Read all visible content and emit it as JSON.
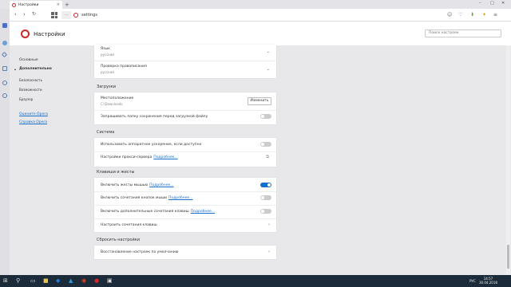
{
  "window": {
    "tab_title": "Настройки",
    "tab_close": "×",
    "new_tab": "+",
    "controls": [
      "–",
      "□",
      "✕"
    ]
  },
  "toolbar": {
    "back": "‹",
    "forward": "›",
    "reload": "↻",
    "url_badge": "···",
    "url": "settings",
    "right_icons": [
      "☺",
      "♡",
      "⬇",
      "✦",
      "≡"
    ]
  },
  "header": {
    "title": "Настройки",
    "search_placeholder": "Поиск настроек"
  },
  "leftnav": {
    "basic": "Основные",
    "advanced": "Дополнительно",
    "security": "Безопасность",
    "features": "Возможности",
    "browser": "Браузер",
    "rate": "Оцените Opera",
    "help": "Справка Opera"
  },
  "language_card": {
    "language_label": "Язык",
    "language_value": "русский",
    "spell_label": "Проверка правописания",
    "spell_value": "русский"
  },
  "downloads": {
    "section": "Загрузки",
    "location_label": "Местоположение",
    "location_value": "C:\\Downloads",
    "change_button": "Изменить",
    "ask_label": "Запрашивать папку сохранения перед загрузкой файлу"
  },
  "system": {
    "section": "Система",
    "hw_accel": "Использовать аппаратное ускорение, если доступно",
    "proxy": "Настройки прокси-сервера",
    "proxy_more": "Подробнее..."
  },
  "shortcuts": {
    "section": "Клавиши и жесты",
    "mouse_gestures": "Включить жесты мышью",
    "mouse_gestures_more": "Подробнее...",
    "rocker": "Включить сочетания кнопок мыши",
    "rocker_more": "Подробнее...",
    "advanced_keys": "Включить дополнительные сочетания клавиш",
    "advanced_keys_more": "Подробнее...",
    "configure": "Настроить сочетания клавиш"
  },
  "reset": {
    "section": "Сбросить настройки",
    "restore": "Восстановление настроек по умолчанию"
  },
  "toggles": {
    "ask_download": false,
    "hw_accel": false,
    "mouse_gestures": true,
    "rocker": false,
    "advanced_keys": false
  },
  "taskbar": {
    "start": "⊞",
    "search": "⚲",
    "apps": [
      "▭",
      "■",
      "◆",
      "▲",
      "◉",
      "●",
      "▣"
    ],
    "lang": "РУС",
    "time": "14:57",
    "date": "30.04.2018"
  },
  "colors": {
    "accent": "#1a6fc9",
    "brand": "#d2232a"
  }
}
